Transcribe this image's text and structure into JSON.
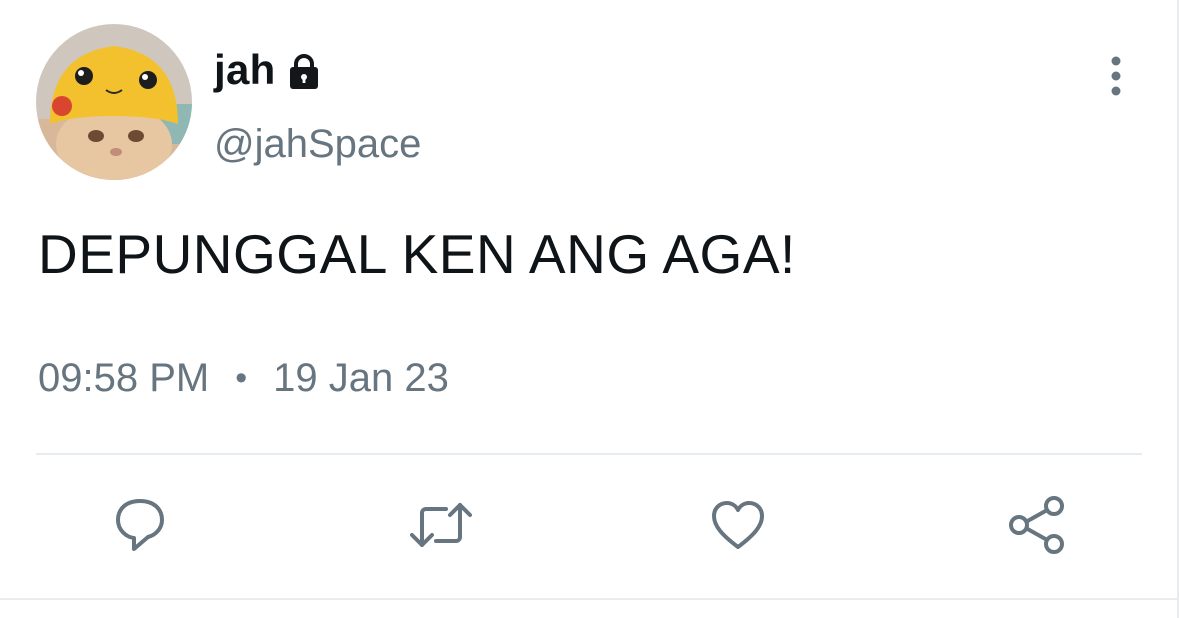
{
  "user": {
    "display_name": "jah",
    "handle": "@jahSpace",
    "avatar_icon": "cat-in-pikachu-hat-avatar",
    "protected_icon": "lock-icon"
  },
  "tweet": {
    "text": "DEPUNGGAL KEN ANG AGA!",
    "time": "09:58 PM",
    "separator": "•",
    "date": "19 Jan 23"
  },
  "actions": [
    {
      "name": "reply",
      "icon": "reply-icon"
    },
    {
      "name": "retweet",
      "icon": "retweet-icon"
    },
    {
      "name": "like",
      "icon": "heart-icon"
    },
    {
      "name": "share",
      "icon": "share-icon"
    }
  ],
  "colors": {
    "text_primary": "#0f1419",
    "text_secondary": "#66757f",
    "icon": "#66757f",
    "divider": "#e6ecf0"
  }
}
